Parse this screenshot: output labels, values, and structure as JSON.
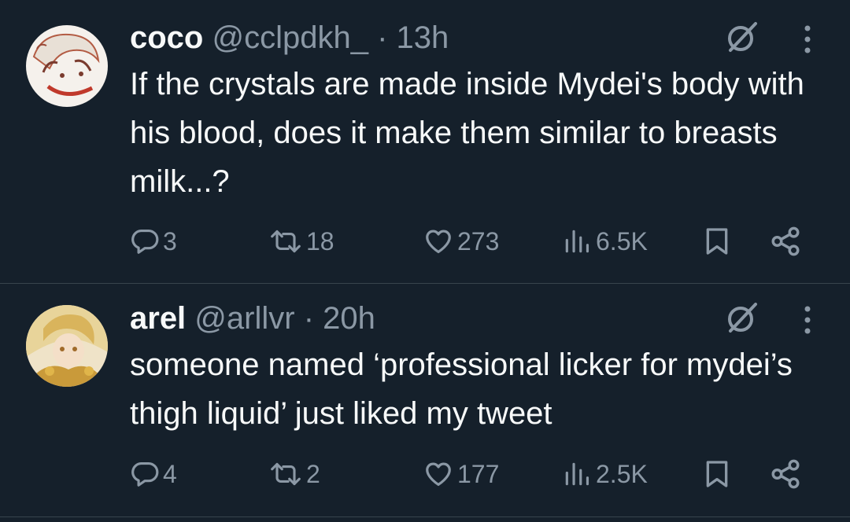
{
  "tweets": [
    {
      "name": "coco",
      "handle": "@cclpdkh_",
      "separator": "·",
      "time": "13h",
      "text": "If the crystals are made inside Mydei's body with his blood, does it make them similar to breasts milk...?",
      "replies": "3",
      "reposts": "18",
      "likes": "273",
      "views": "6.5K"
    },
    {
      "name": "arel",
      "handle": "@arllvr",
      "separator": "·",
      "time": "20h",
      "text": "someone named ‘professional licker for mydei’s thigh liquid’ just liked my tweet",
      "replies": "4",
      "reposts": "2",
      "likes": "177",
      "views": "2.5K"
    }
  ],
  "icons": {
    "reply": "reply-icon",
    "repost": "repost-icon",
    "like": "heart-icon",
    "views": "views-icon",
    "bookmark": "bookmark-icon",
    "share": "share-icon",
    "grok": "grok-icon",
    "more": "more-icon"
  },
  "colors": {
    "background": "#15202b",
    "text": "#f7f9f9",
    "secondary": "#8b98a5",
    "divider": "#38444d"
  }
}
